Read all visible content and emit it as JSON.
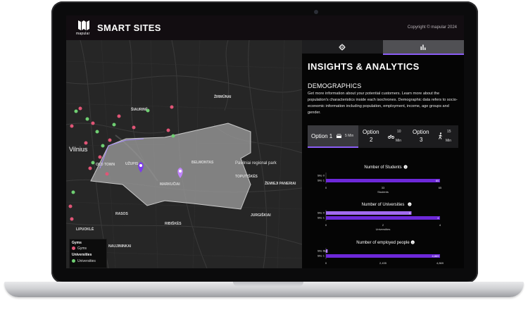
{
  "header": {
    "logo_text": "mapular",
    "app_title": "SMART SITES",
    "copyright": "Copyright © mapular 2024"
  },
  "tabs": [
    {
      "icon": "gear-icon",
      "active": false
    },
    {
      "icon": "bar-chart-icon",
      "active": true
    }
  ],
  "map": {
    "labels": {
      "city": "Vilnius",
      "park": "Pavilniai regional park",
      "uzupis": "UŽUPIS",
      "belmontas": "BELMONTAS",
      "markuciai": "MARKUČIAI",
      "toputiskes": "TOPUTIŠKĖS",
      "rasos": "RASOS",
      "zemieji": "ŽEMIEJI PANERIAI",
      "ribiskes": "RIBIŠKĖS",
      "jurgiskiai": "JURGIŠKIAI",
      "lipuokle": "LIPUOKLĖ",
      "oldtown": "OLD TOWN",
      "naujininkai": "NAUJININKAI",
      "naujininkai2": "ŽIRMŪNAI",
      "sirvydai": "ŠIAURINĖ"
    },
    "legend": {
      "gyms_header": "Gyms",
      "gyms_label": "Gyms",
      "universities_header": "Universities",
      "universities_label": "Universities",
      "gyms_color": "#e05576",
      "universities_color": "#6fcf72"
    }
  },
  "panel": {
    "title": "INSIGHTS & ANALYTICS",
    "section": "DEMOGRAPHICS",
    "description": "Get more information about your potential customers. Learn more about the population's characteristics inside each isochrones. Demographic data refers to socio-economic information including population, employment, income, age groups and gender.",
    "options": [
      {
        "label": "Option 1",
        "minutes": "5",
        "unit": "Min",
        "icon": "car-icon",
        "selected": true
      },
      {
        "label": "Option",
        "label2": "2",
        "minutes": "10",
        "unit": "Min",
        "icon": "bicycle-icon",
        "selected": false
      },
      {
        "label": "Option",
        "label2": "3",
        "minutes": "15",
        "unit": "Min",
        "icon": "walking-icon",
        "selected": false
      }
    ],
    "accent": "#7c3aed",
    "site0_color": "#a26bf0",
    "site1_color": "#6d28d9"
  },
  "chart_data": [
    {
      "type": "bar",
      "title": "Number of Students",
      "categories": [
        "Site 0",
        "Site 1"
      ],
      "values": [
        0,
        65
      ],
      "value_labels": [
        "",
        "65"
      ],
      "ticks": [
        "0",
        "33",
        "65"
      ],
      "xlabel": "Students",
      "xlim": [
        0,
        65
      ]
    },
    {
      "type": "bar",
      "title": "Number of Universities",
      "categories": [
        "Site 0",
        "Site 1"
      ],
      "values": [
        3,
        4
      ],
      "value_labels": [
        "3",
        "4"
      ],
      "ticks": [
        "0",
        "2",
        "4"
      ],
      "xlabel": "Universities",
      "xlim": [
        0,
        4
      ]
    },
    {
      "type": "bar",
      "title": "Number of employed people",
      "categories": [
        "Site 0",
        "Site 1"
      ],
      "values": [
        72,
        4869
      ],
      "value_labels": [
        "72",
        "4,869"
      ],
      "ticks": [
        "0",
        "2,435",
        "4,869"
      ],
      "xlabel": "",
      "xlim": [
        0,
        4869
      ]
    }
  ]
}
